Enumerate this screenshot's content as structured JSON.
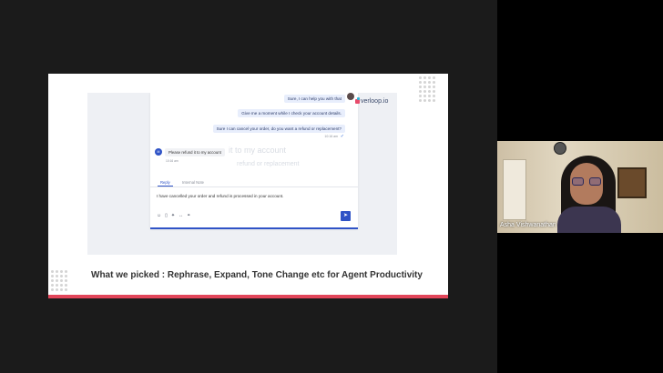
{
  "slide": {
    "caption": "What we picked :  Rephrase, Expand, Tone Change etc for Agent Productivity",
    "accent_color": "#e2465a",
    "screenshot": {
      "brand_logo_text": "verloop.io",
      "agent_messages": [
        "Sure, I can help you with that",
        "Give me a moment while I check your account details.",
        "Sure I can cancel your order, do you want a refund or replacement?"
      ],
      "agent_message_time": "10:16 am",
      "customer_avatar_initials": "M",
      "customer_message": "Please refund it to my account",
      "customer_message_time": "10:16 am",
      "ghost_text": [
        "it to my account",
        "refund or replacement"
      ],
      "tabs": [
        "Reply",
        "Internal Note"
      ],
      "reply_text": "I have cancelled your order and refund is processed in your account.",
      "toolbar_icons": [
        "emoji-icon",
        "template-icon",
        "ai-rephrase-icon",
        "expand-icon",
        "attach-icon"
      ],
      "send_icon": "send-icon",
      "brand_color": "#2f53c6"
    }
  },
  "participant": {
    "name": "Asha Vishwanathan"
  }
}
